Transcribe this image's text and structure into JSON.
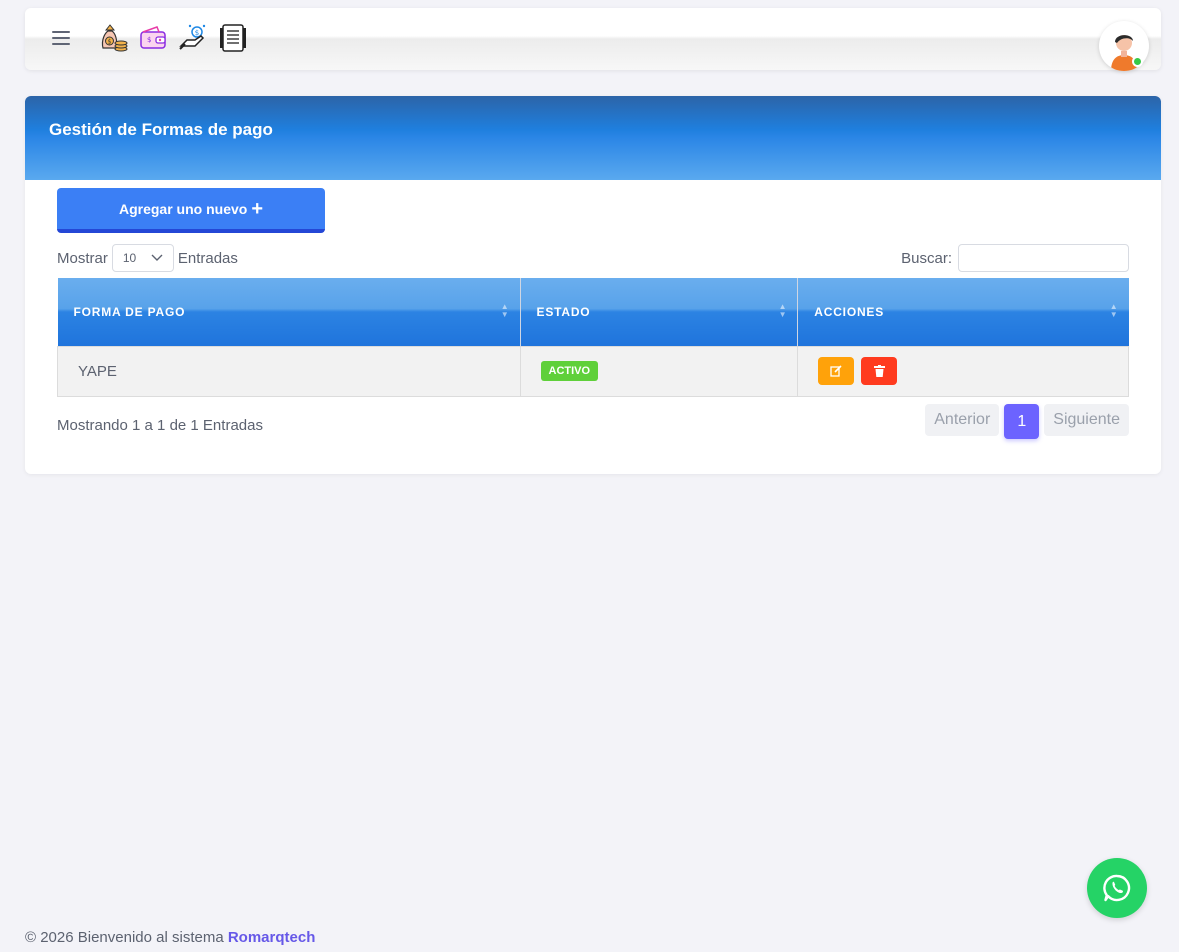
{
  "navbar": {
    "icons": [
      "menu-icon",
      "money-bag-icon",
      "wallet-icon",
      "hand-money-icon",
      "receipt-icon"
    ],
    "user_status": "online"
  },
  "card": {
    "title": "Gestión de Formas de pago",
    "add_button": "Agregar uno nuevo",
    "show_label": "Mostrar",
    "page_length": "10",
    "entries_label": "Entradas",
    "search_label": "Buscar:",
    "search_value": ""
  },
  "table": {
    "headers": [
      "FORMA DE PAGO",
      "ESTADO",
      "ACCIONES"
    ],
    "rows": [
      {
        "forma_de_pago": "YAPE",
        "estado": "ACTIVO"
      }
    ]
  },
  "pagination": {
    "info": "Mostrando 1 a 1 de 1 Entradas",
    "previous": "Anterior",
    "current": "1",
    "next": "Siguiente"
  },
  "footer": {
    "text": "© 2026 Bienvenido al sistema",
    "brand": "Romarqtech"
  },
  "colors": {
    "header_blue": "#1f7fde",
    "add_button": "#3b7ff5",
    "active_badge": "#5fd03a",
    "edit_button": "#ffa20a",
    "delete_button": "#ff3b1f",
    "page_active": "#6c63ff",
    "whatsapp": "#25d366",
    "brand": "#6658e8"
  }
}
